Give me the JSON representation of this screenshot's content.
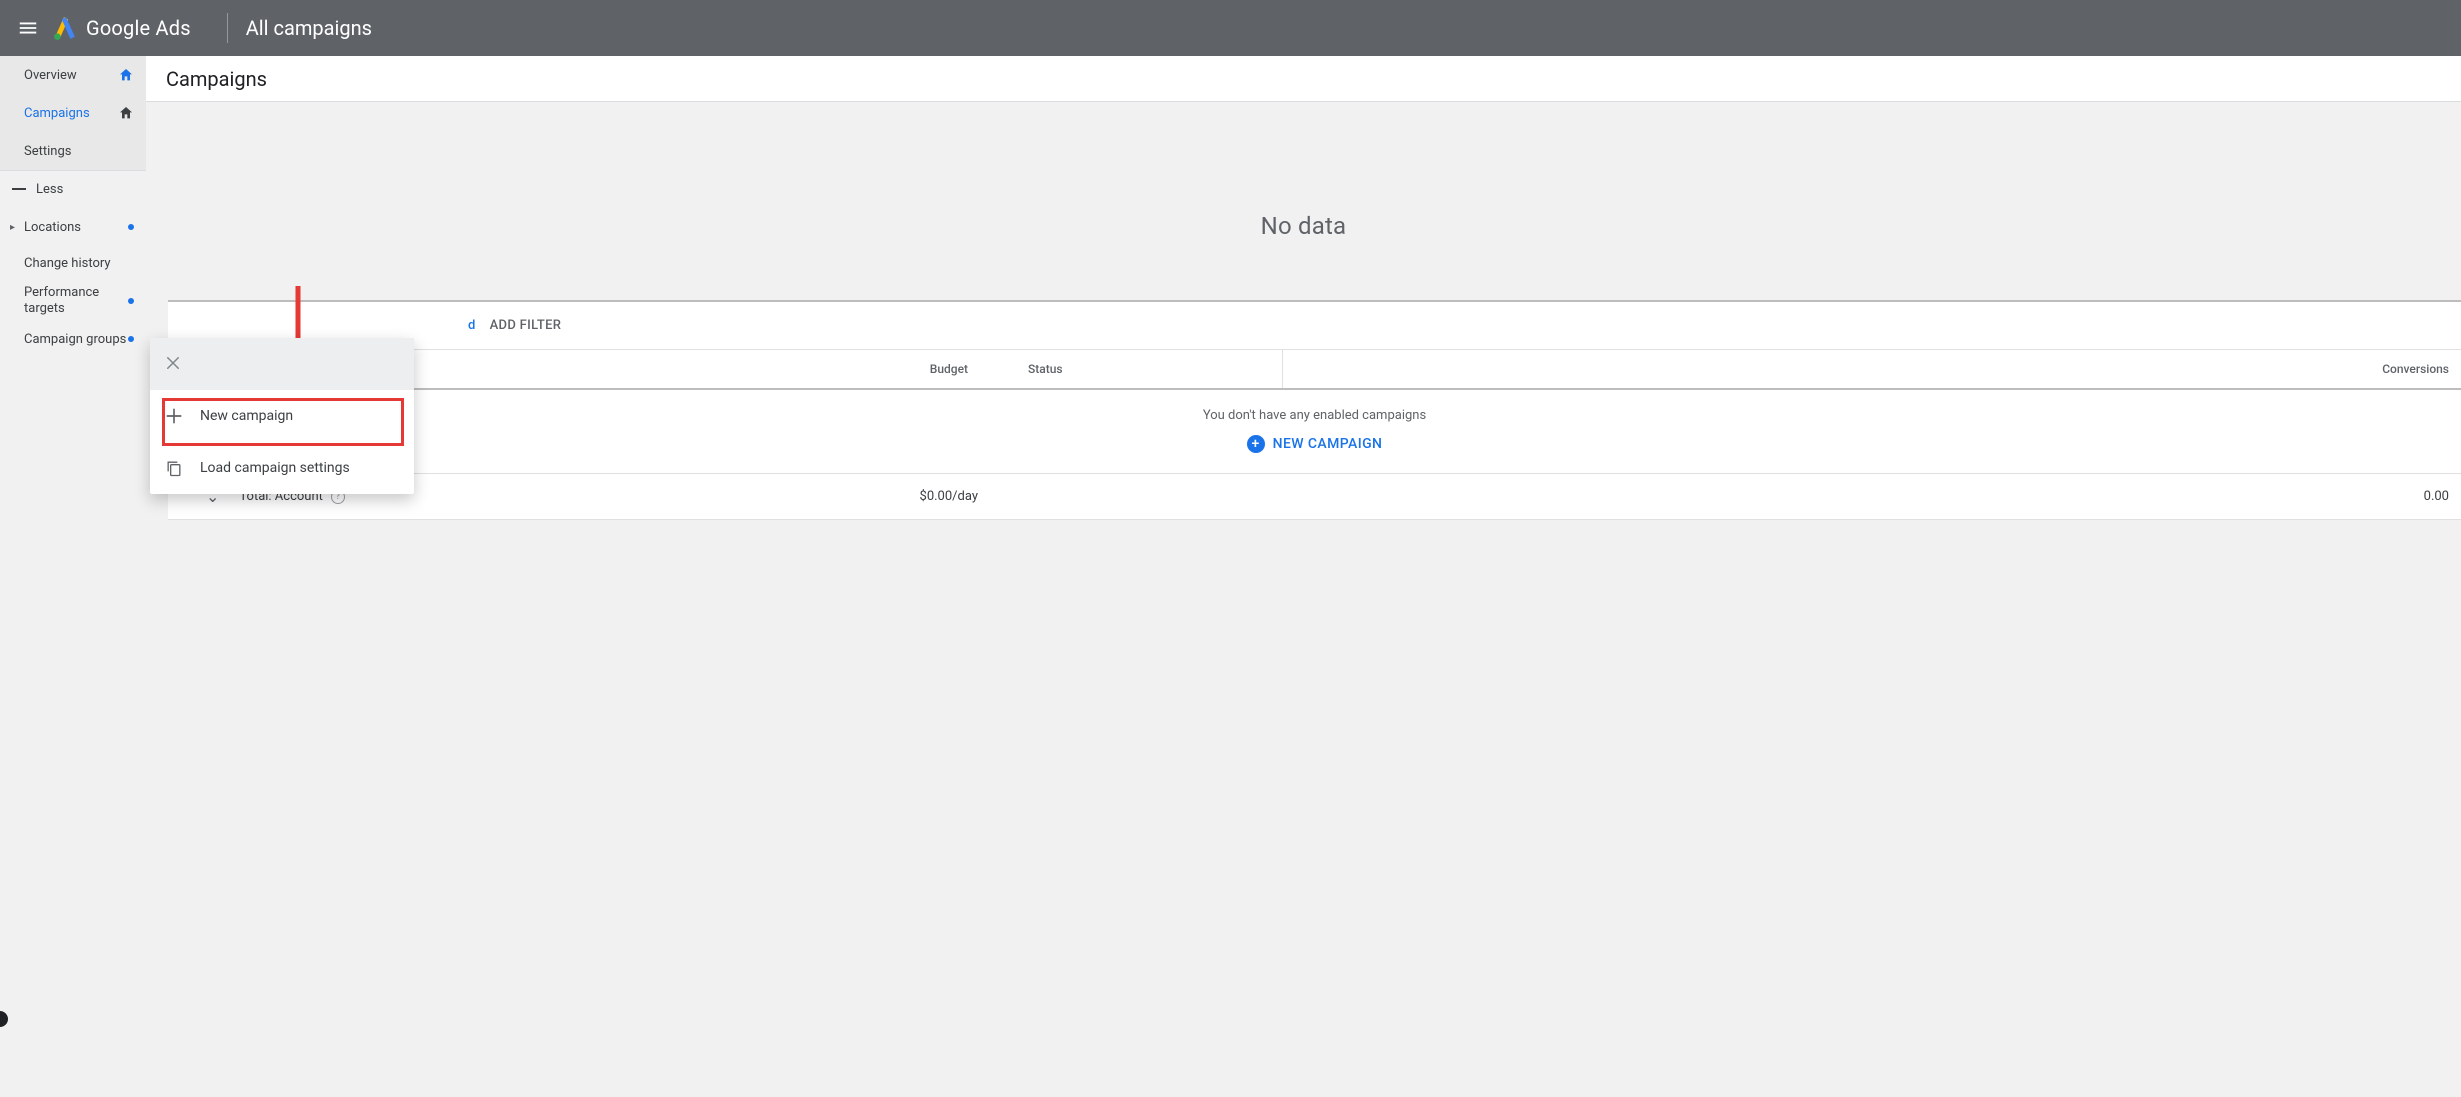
{
  "header": {
    "brand": "Google Ads",
    "scope": "All campaigns"
  },
  "sidebar": {
    "nav": [
      {
        "label": "Overview"
      },
      {
        "label": "Campaigns"
      },
      {
        "label": "Settings"
      }
    ],
    "less": "Less",
    "sub": [
      {
        "label": "Locations",
        "caret": true,
        "dot": true
      },
      {
        "label": "Change history"
      },
      {
        "label": "Performance targets",
        "dot": true,
        "multi": true
      },
      {
        "label": "Campaign groups",
        "dot": true
      }
    ]
  },
  "page": {
    "title": "Campaigns",
    "no_data": "No data",
    "filter_enabled": "d",
    "add_filter": "ADD FILTER",
    "columns": {
      "budget": "Budget",
      "status": "Status",
      "conversions": "Conversions"
    },
    "empty_msg": "You don't have any enabled campaigns",
    "new_campaign_btn": "NEW CAMPAIGN",
    "total": {
      "label": "Total: Account",
      "budget": "$0.00/day",
      "conversions": "0.00"
    }
  },
  "popover": {
    "new_campaign": "New campaign",
    "load_settings": "Load campaign settings"
  }
}
